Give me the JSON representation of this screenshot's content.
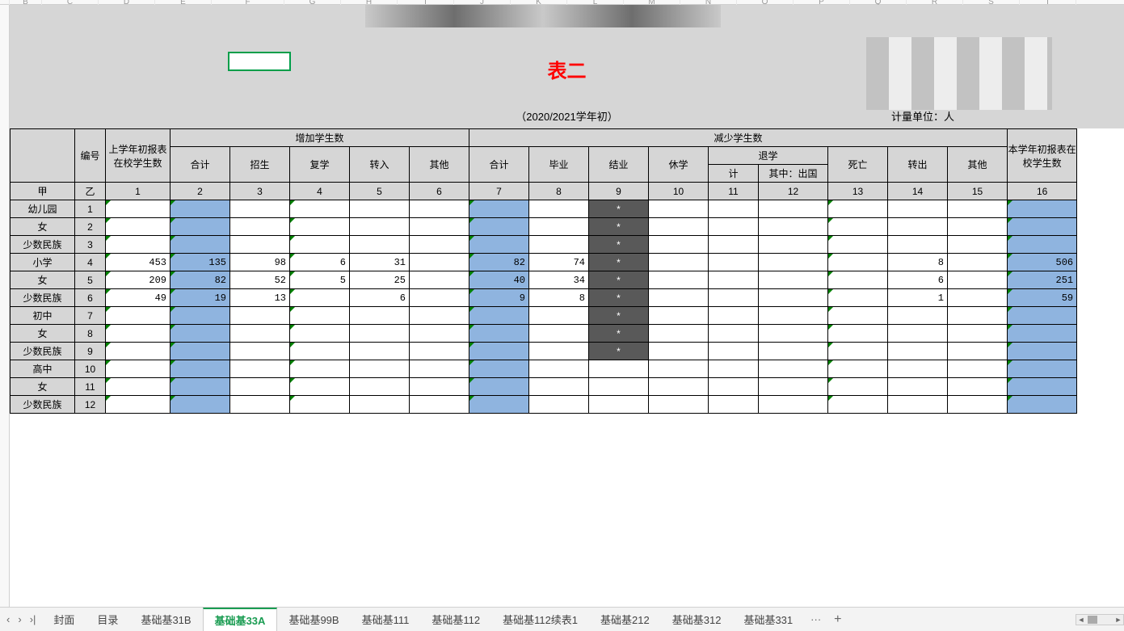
{
  "col_letters": [
    "B",
    "C",
    "D",
    "E",
    "F",
    "G",
    "H",
    "I",
    "J",
    "K",
    "L",
    "M",
    "N",
    "O",
    "P",
    "Q",
    "R",
    "S",
    "T"
  ],
  "title": "表二",
  "period": "（2020/2021学年初）",
  "unit": "计量单位：人",
  "headers": {
    "row_label": "",
    "id": "编号",
    "prev": "上学年初报表在校学生数",
    "inc_group": "增加学生数",
    "inc": {
      "total": "合计",
      "enroll": "招生",
      "resume": "复学",
      "transfer_in": "转入",
      "other": "其他"
    },
    "dec_group": "减少学生数",
    "dec": {
      "total": "合计",
      "graduate": "毕业",
      "complete": "结业",
      "suspend": "休学",
      "dropout_group": "退学",
      "dropout_total": "计",
      "dropout_abroad": "其中：出国",
      "death": "死亡",
      "transfer_out": "转出",
      "other": "其他"
    },
    "curr": "本学年初报表在校学生数",
    "col_ids_row_label": "甲",
    "col_ids_id": "乙",
    "col_ids": [
      "1",
      "2",
      "3",
      "4",
      "5",
      "6",
      "7",
      "8",
      "9",
      "10",
      "11",
      "12",
      "13",
      "14",
      "15",
      "16"
    ]
  },
  "rows": [
    {
      "label": "幼儿园",
      "id": "1",
      "dark9": "*"
    },
    {
      "label": "女",
      "id": "2",
      "dark9": "*"
    },
    {
      "label": "少数民族",
      "id": "3",
      "dark9": "*"
    },
    {
      "label": "小学",
      "id": "4",
      "c1": 453,
      "c2": 135,
      "c3": 98,
      "c4": 6,
      "c5": 31,
      "c7": 82,
      "c8": 74,
      "dark9": "*",
      "c14": 8,
      "c16": 506
    },
    {
      "label": "女",
      "id": "5",
      "c1": 209,
      "c2": 82,
      "c3": 52,
      "c4": 5,
      "c5": 25,
      "c7": 40,
      "c8": 34,
      "dark9": "*",
      "c14": 6,
      "c16": 251
    },
    {
      "label": "少数民族",
      "id": "6",
      "c1": 49,
      "c2": 19,
      "c3": 13,
      "c5": 6,
      "c7": 9,
      "c8": 8,
      "dark9": "*",
      "c14": 1,
      "c16": 59
    },
    {
      "label": "初中",
      "id": "7",
      "dark9": "*"
    },
    {
      "label": "女",
      "id": "8",
      "dark9": "*"
    },
    {
      "label": "少数民族",
      "id": "9",
      "dark9": "*"
    },
    {
      "label": "高中",
      "id": "10"
    },
    {
      "label": "女",
      "id": "11"
    },
    {
      "label": "少数民族",
      "id": "12"
    }
  ],
  "tabs": {
    "items": [
      "封面",
      "目录",
      "基础基31B",
      "基础基33A",
      "基础基99B",
      "基础基111",
      "基础基112",
      "基础基112续表1",
      "基础基212",
      "基础基312",
      "基础基331"
    ],
    "active_index": 3,
    "more": "···",
    "add": "+"
  }
}
